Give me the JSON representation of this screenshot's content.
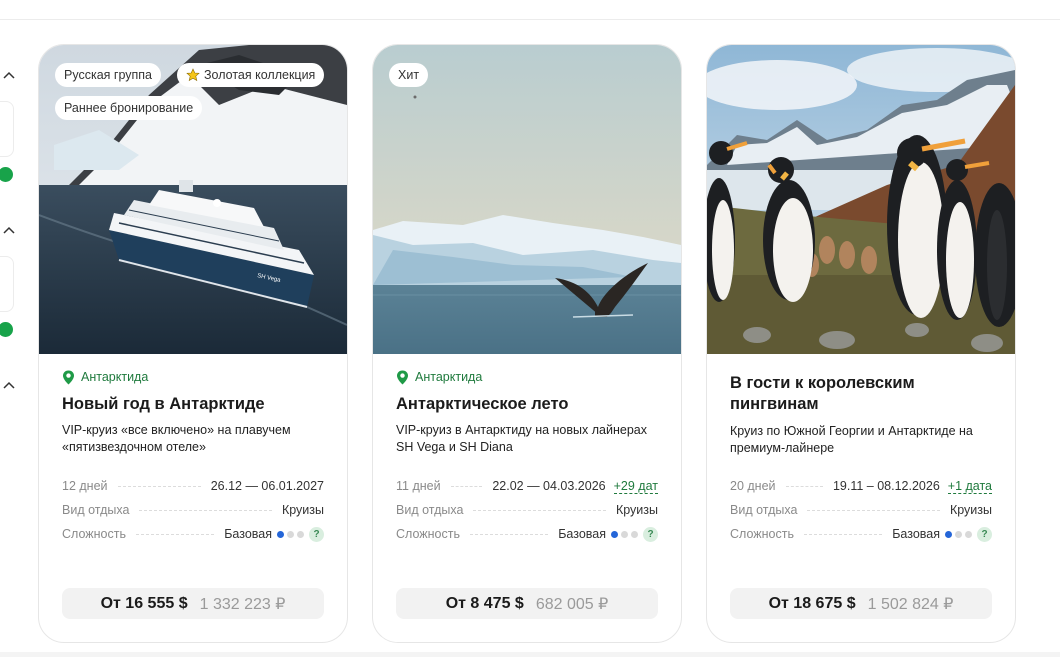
{
  "cards": [
    {
      "tags": [
        "Русская группа",
        "Золотая коллекция",
        "Раннее бронирование"
      ],
      "location": "Антарктида",
      "title": "Новый год в Антарктиде",
      "description": "VIP-круиз «все включено» на плавучем «пятизвездочном отеле»",
      "duration": "12 дней",
      "dates": "26.12 — 06.01.2027",
      "extra_dates": "",
      "type_label": "Вид отдыха",
      "type_value": "Круизы",
      "difficulty_label": "Сложность",
      "difficulty_value": "Базовая",
      "price_from": "От 16 555 $",
      "price_rub": "1 332 223 ₽",
      "image": "cruise-ship-antarctica"
    },
    {
      "tags": [
        "Хит"
      ],
      "location": "Антарктида",
      "title": "Антарктическое лето",
      "description": "VIP-круиз в Антарктиду на новых лайнерах SH Vega и SH Diana",
      "duration": "11 дней",
      "dates": "22.02 — 04.03.2026",
      "extra_dates": "+29 дат",
      "type_label": "Вид отдыха",
      "type_value": "Круизы",
      "difficulty_label": "Сложность",
      "difficulty_value": "Базовая",
      "price_from": "От 8 475 $",
      "price_rub": "682 005 ₽",
      "image": "whale-tail-iceberg"
    },
    {
      "tags": [],
      "location": "",
      "title": "В гости к королевским пингвинам",
      "description": "Круиз по Южной Георгии и Антарктиде на премиум-лайнере",
      "duration": "20 дней",
      "dates": "19.11 – 08.12.2026",
      "extra_dates": "+1 дата",
      "type_label": "Вид отдыха",
      "type_value": "Круизы",
      "difficulty_label": "Сложность",
      "difficulty_value": "Базовая",
      "price_from": "От 18 675 $",
      "price_rub": "1 502 824 ₽",
      "image": "king-penguins"
    }
  ],
  "ship_name": "SH Vega",
  "colors": {
    "location_green": "#1f7a3d",
    "difficulty_dot_active": "#2566d8",
    "sidebar_dot": "#18a34a"
  }
}
